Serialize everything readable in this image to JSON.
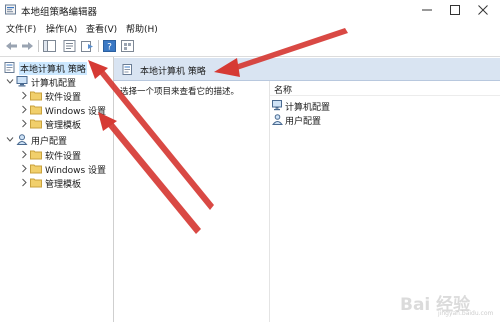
{
  "window": {
    "title": "本地组策略编辑器"
  },
  "menu": {
    "items": [
      "文件(F)",
      "操作(A)",
      "查看(V)",
      "帮助(H)"
    ]
  },
  "tree": {
    "root": "本地计算机 策略",
    "computer_config": "计算机配置",
    "computer_children": [
      "软件设置",
      "Windows 设置",
      "管理模板"
    ],
    "user_config": "用户配置",
    "user_children": [
      "软件设置",
      "Windows 设置",
      "管理模板"
    ]
  },
  "right": {
    "header": "本地计算机 策略",
    "description": "选择一个项目来查看它的描述。",
    "column_name": "名称",
    "items": [
      "计算机配置",
      "用户配置"
    ]
  },
  "watermark": {
    "text": "Bai 经验",
    "sub": "jingyan.baidu.com"
  },
  "colors": {
    "arrow": "#d63a34",
    "header_bg": "#d9e4f2",
    "selected_bg": "#cce8ff",
    "folder": "#e8c25a"
  },
  "icons": [
    "policy-editor-icon",
    "minimize-icon",
    "maximize-icon",
    "close-icon",
    "back-arrow-icon",
    "forward-arrow-icon",
    "folder-icon",
    "computer-icon",
    "user-icon",
    "help-icon"
  ]
}
